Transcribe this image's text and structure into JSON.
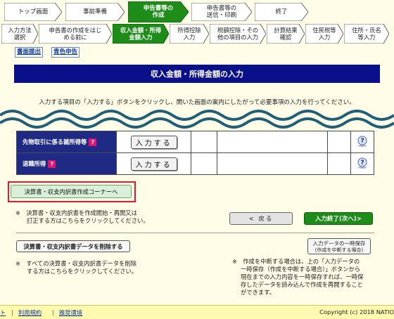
{
  "steps": {
    "top": "トップ画面",
    "prep": "事前準備",
    "create": [
      "申告書等の",
      "作成"
    ],
    "send": [
      "申告書等の",
      "送信・印刷"
    ],
    "finish": "終了"
  },
  "substeps": [
    {
      "lines": [
        "入力方法",
        "選択"
      ]
    },
    {
      "lines": [
        "申告書の作成をはじ",
        "める前に"
      ]
    },
    {
      "lines": [
        "収入金額・所得",
        "金額入力"
      ]
    },
    {
      "lines": [
        "所得控除",
        "入力"
      ]
    },
    {
      "lines": [
        "税額控除・その",
        "他の項目の入力"
      ]
    },
    {
      "lines": [
        "計算結果",
        "確認"
      ]
    },
    {
      "lines": [
        "住民税等",
        "入力"
      ]
    },
    {
      "lines": [
        "住所・氏名",
        "等入力"
      ]
    }
  ],
  "links": {
    "filing": "書面提出",
    "blue": "青色申告"
  },
  "page_title": "収入金額・所得金額の入力",
  "instruction": "入力する項目の「入力する」ボタンをクリックし、開いた画面の案内にしたがって必要事項の入力を行ってください。",
  "rows": [
    {
      "label": "先物取引に係る雑所得等",
      "qmark": "?",
      "button": "入力する"
    },
    {
      "label": "退職所得",
      "qmark": "?",
      "button": "入力する"
    }
  ],
  "corner_button": "決算書・収支内訳書作成コーナーへ",
  "corner_note": [
    "※　決算書・収支内訳書を作成開始・再開又は",
    "訂正する方はこちらをクリックしてください。"
  ],
  "back_button": "< 戻る",
  "next_button": "入力終了(次へ)>",
  "delete_button": "決算書・収支内訳書データを削除する",
  "delete_note": [
    "※　すべての決算書・収支内訳書データを削除",
    "する方はこちらをクリックしてください。"
  ],
  "save_button": [
    "入力データの一時保存",
    "(作成を中断する場合)"
  ],
  "save_note": [
    "※　作成を中断する場合は、上の「入力データの",
    "一時保存（作成を中断する場合）」ボタンから",
    "現在までの入力内容を一時保存すれば、一時保",
    "存したデータを読み込んで作成を再開すること",
    "ができます。"
  ],
  "footer": {
    "fragment": "ト",
    "terms": "利用規約",
    "env": "推奨環境",
    "sep": "|",
    "copyright": "Copyright (c) 2018 NATIO"
  }
}
